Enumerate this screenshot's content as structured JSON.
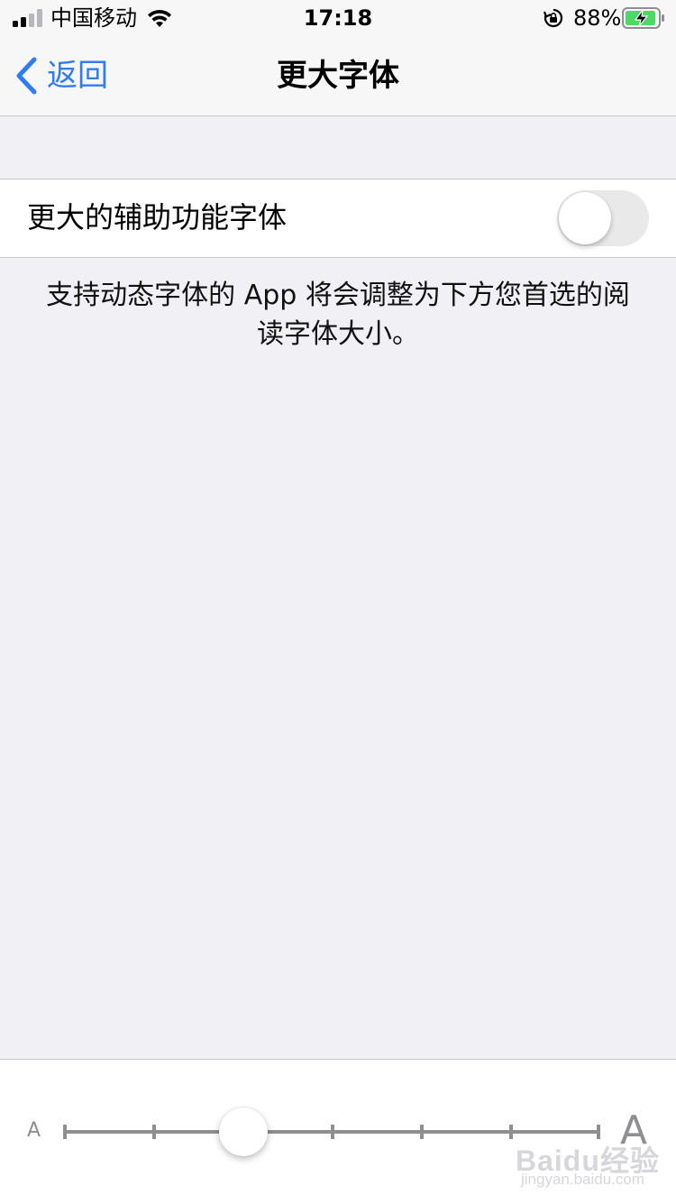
{
  "status_bar": {
    "carrier": "中国移动",
    "time": "17:18",
    "battery_percent": "88%",
    "icons": [
      "signal-icon",
      "wifi-icon",
      "orientation-lock-icon",
      "battery-charging-icon"
    ],
    "battery_color": "#4cd964"
  },
  "nav": {
    "back_label": "返回",
    "title": "更大字体",
    "accent_color": "#2f7cf6"
  },
  "settings": {
    "larger_accessibility_label": "更大的辅助功能字体",
    "larger_accessibility_on": false,
    "description": "支持动态字体的 App 将会调整为下方您首选的阅读字体大小。"
  },
  "slider": {
    "small_label": "A",
    "large_label": "A",
    "steps": 7,
    "selected_index": 2
  },
  "watermark": {
    "main": "Baidu经验",
    "sub": "jingyan.baidu.com"
  }
}
